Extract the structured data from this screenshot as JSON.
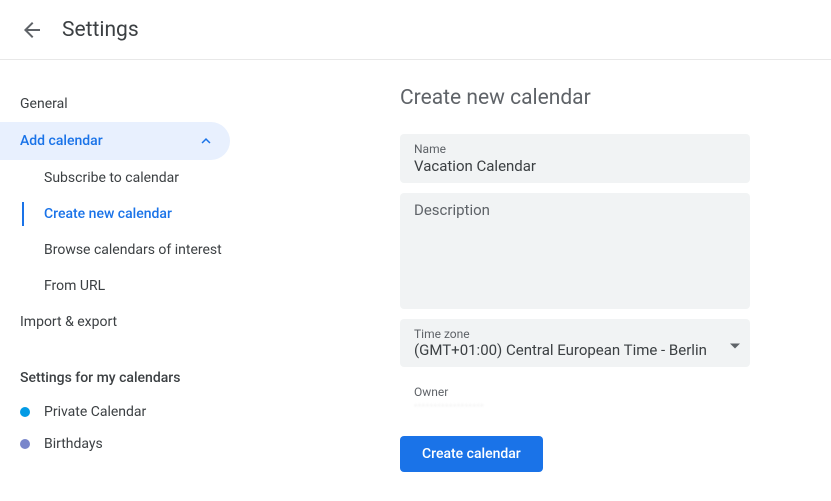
{
  "header": {
    "title": "Settings"
  },
  "sidebar": {
    "general": "General",
    "addCalendar": "Add calendar",
    "subItems": {
      "subscribe": "Subscribe to calendar",
      "createNew": "Create new calendar",
      "browse": "Browse calendars of interest",
      "fromUrl": "From URL"
    },
    "importExport": "Import & export",
    "settingsHeading": "Settings for my calendars",
    "calendars": [
      {
        "label": "Private Calendar",
        "color": "#039be5"
      },
      {
        "label": "Birthdays",
        "color": "#7986cb"
      }
    ]
  },
  "main": {
    "title": "Create new calendar",
    "nameLabel": "Name",
    "nameValue": "Vacation Calendar",
    "descriptionLabel": "Description",
    "descriptionValue": "",
    "timezoneLabel": "Time zone",
    "timezoneValue": "(GMT+01:00) Central European Time - Berlin",
    "ownerLabel": "Owner",
    "ownerValue": "··················",
    "createButton": "Create calendar"
  }
}
